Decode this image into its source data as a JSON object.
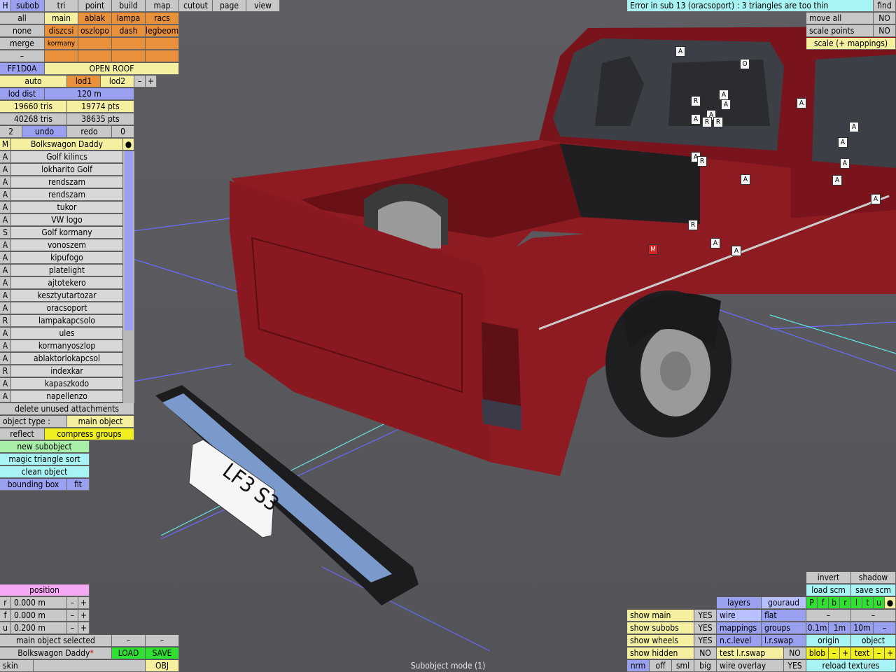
{
  "menu": {
    "h": "H",
    "items": [
      "subob",
      "tri",
      "point",
      "build",
      "map",
      "cutout",
      "page",
      "view"
    ]
  },
  "error_text": "Error in sub 13 (oracsoport) : 3 triangles are too thin",
  "find": "find",
  "right_top": {
    "move_all": "move all",
    "move_all_val": "NO",
    "scale_points": "scale points",
    "scale_points_val": "NO",
    "scale_map": "scale (+ mappings)"
  },
  "sel": {
    "all": "all",
    "none": "none",
    "merge": "merge",
    "dash": "–"
  },
  "groups": [
    [
      "main",
      "ablak",
      "lampa",
      "racs"
    ],
    [
      "diszcsi",
      "oszlopo",
      "dash",
      "legbeom"
    ],
    [
      "kormany",
      "",
      "",
      ""
    ],
    [
      "",
      "",
      "",
      ""
    ]
  ],
  "color_code": "FF1D0A",
  "open_roof": "OPEN ROOF",
  "lod": {
    "auto": "auto",
    "lod1": "lod1",
    "lod2": "lod2",
    "minus": "–",
    "plus": "+"
  },
  "lod_dist_label": "lod dist",
  "lod_dist_val": "120 m",
  "stats": {
    "tris1": "19660 tris",
    "pts1": "19774 pts",
    "tris2": "40268 tris",
    "pts2": "38635 pts"
  },
  "undo_row": {
    "n": "2",
    "undo": "undo",
    "redo": "redo",
    "r": "0"
  },
  "model_header": {
    "m": "M",
    "name": "Bolkswagon Daddy",
    "dot": "●"
  },
  "subobjects": [
    {
      "t": "A",
      "n": "Golf kilincs"
    },
    {
      "t": "A",
      "n": "lokharito Golf"
    },
    {
      "t": "A",
      "n": "rendszam"
    },
    {
      "t": "A",
      "n": "rendszam"
    },
    {
      "t": "A",
      "n": "tukor"
    },
    {
      "t": "A",
      "n": "VW logo"
    },
    {
      "t": "S",
      "n": "Golf kormany"
    },
    {
      "t": "A",
      "n": "vonoszem"
    },
    {
      "t": "A",
      "n": "kipufogo"
    },
    {
      "t": "A",
      "n": "platelight"
    },
    {
      "t": "A",
      "n": "ajtotekero"
    },
    {
      "t": "A",
      "n": "kesztyutartozar"
    },
    {
      "t": "A",
      "n": "oracsoport"
    },
    {
      "t": "R",
      "n": "lampakapcsolo"
    },
    {
      "t": "A",
      "n": "ules"
    },
    {
      "t": "A",
      "n": "kormanyoszlop"
    },
    {
      "t": "A",
      "n": "ablaktorlokapcsol"
    },
    {
      "t": "R",
      "n": "indexkar"
    },
    {
      "t": "A",
      "n": "kapaszkodo"
    },
    {
      "t": "A",
      "n": "napellenzo"
    }
  ],
  "delete_unused": "delete unused attachments",
  "object_type_label": "object type :",
  "object_type_val": "main object",
  "reflect": "reflect",
  "compress": "compress groups",
  "actions": {
    "new_sub": "new subobject",
    "magic": "magic triangle sort",
    "clean": "clean object",
    "bbox": "bounding box",
    "fit": "fit"
  },
  "position": {
    "title": "position",
    "rows": [
      {
        "k": "r",
        "v": "0.000 m"
      },
      {
        "k": "f",
        "v": "0.000 m"
      },
      {
        "k": "u",
        "v": "0.200 m"
      }
    ],
    "minus": "–",
    "plus": "+"
  },
  "main_sel": "main object selected",
  "dash": "–",
  "model_name": "Bolkswagon Daddy",
  "asterisk": "*",
  "load": "LOAD",
  "save": "SAVE",
  "skin": "skin",
  "obj": "OBJ",
  "status": "Subobject mode (1)",
  "br": {
    "invert": "invert",
    "shadow": "shadow",
    "load_scm": "load scm",
    "save_scm": "save scm",
    "layers": "layers",
    "gouraud": "gouraud",
    "wire": "wire",
    "flat": "flat",
    "mappings": "mappings",
    "groups": "groups",
    "nclevel": "n.c.level",
    "lrswap": "l.r.swap",
    "letters": [
      "P",
      "f",
      "b",
      "r",
      "l",
      "t",
      "u",
      "●"
    ],
    "d1": "0.1m",
    "d2": "1m",
    "d3": "10m",
    "minus": "–",
    "plus": "+",
    "origin": "origin",
    "object": "object",
    "show_main": "show main",
    "show_subobs": "show subobs",
    "show_wheels": "show wheels",
    "show_hidden": "show hidden",
    "yes": "YES",
    "no": "NO",
    "test_lr": "test l.r.swap",
    "blob": "blob",
    "text": "text",
    "nrm": "nrm",
    "off": "off",
    "sml": "sml",
    "big": "big",
    "wire_overlay": "wire overlay",
    "reload": "reload textures"
  },
  "plate": "LF3 S3",
  "markers": [
    "A",
    "O",
    "A",
    "A",
    "R",
    "A",
    "A",
    "R",
    "R",
    "A",
    "R",
    "A",
    "A",
    "A",
    "A",
    "A",
    "A",
    "R",
    "A",
    "M",
    "A",
    "A"
  ],
  "colors": {
    "car": "#8e1a22",
    "floor": "#5a5a5e"
  }
}
